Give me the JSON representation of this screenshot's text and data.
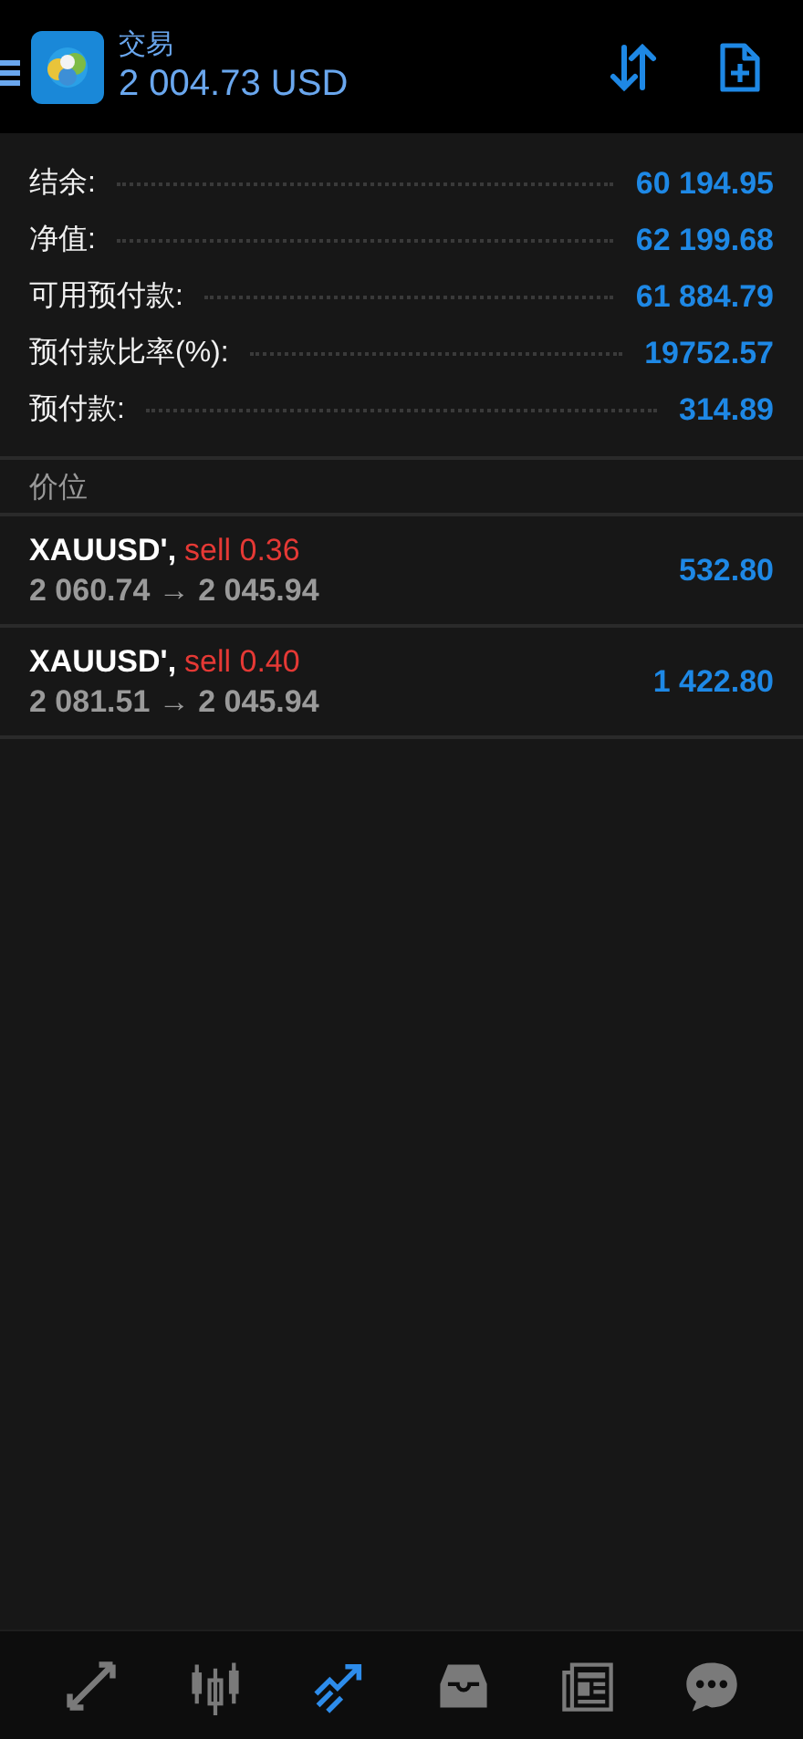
{
  "header": {
    "title": "交易",
    "balance": "2 004.73 USD"
  },
  "summary": [
    {
      "label": "结余:",
      "value": "60 194.95"
    },
    {
      "label": "净值:",
      "value": "62 199.68"
    },
    {
      "label": "可用预付款:",
      "value": "61 884.79"
    },
    {
      "label": "预付款比率(%):",
      "value": "19752.57"
    },
    {
      "label": "预付款:",
      "value": "314.89"
    }
  ],
  "section_title": "价位",
  "positions": [
    {
      "symbol": "XAUUSD',",
      "order": "sell 0.36",
      "prices": "2 060.74 → 2 045.94",
      "profit": "532.80"
    },
    {
      "symbol": "XAUUSD',",
      "order": "sell 0.40",
      "prices": "2 081.51 → 2 045.94",
      "profit": "1 422.80"
    }
  ],
  "bottom_tabs": [
    {
      "kind": "quotes",
      "selected": false
    },
    {
      "kind": "chart",
      "selected": false
    },
    {
      "kind": "trade",
      "selected": true
    },
    {
      "kind": "inbox",
      "selected": false
    },
    {
      "kind": "news",
      "selected": false
    },
    {
      "kind": "chat",
      "selected": false
    }
  ]
}
